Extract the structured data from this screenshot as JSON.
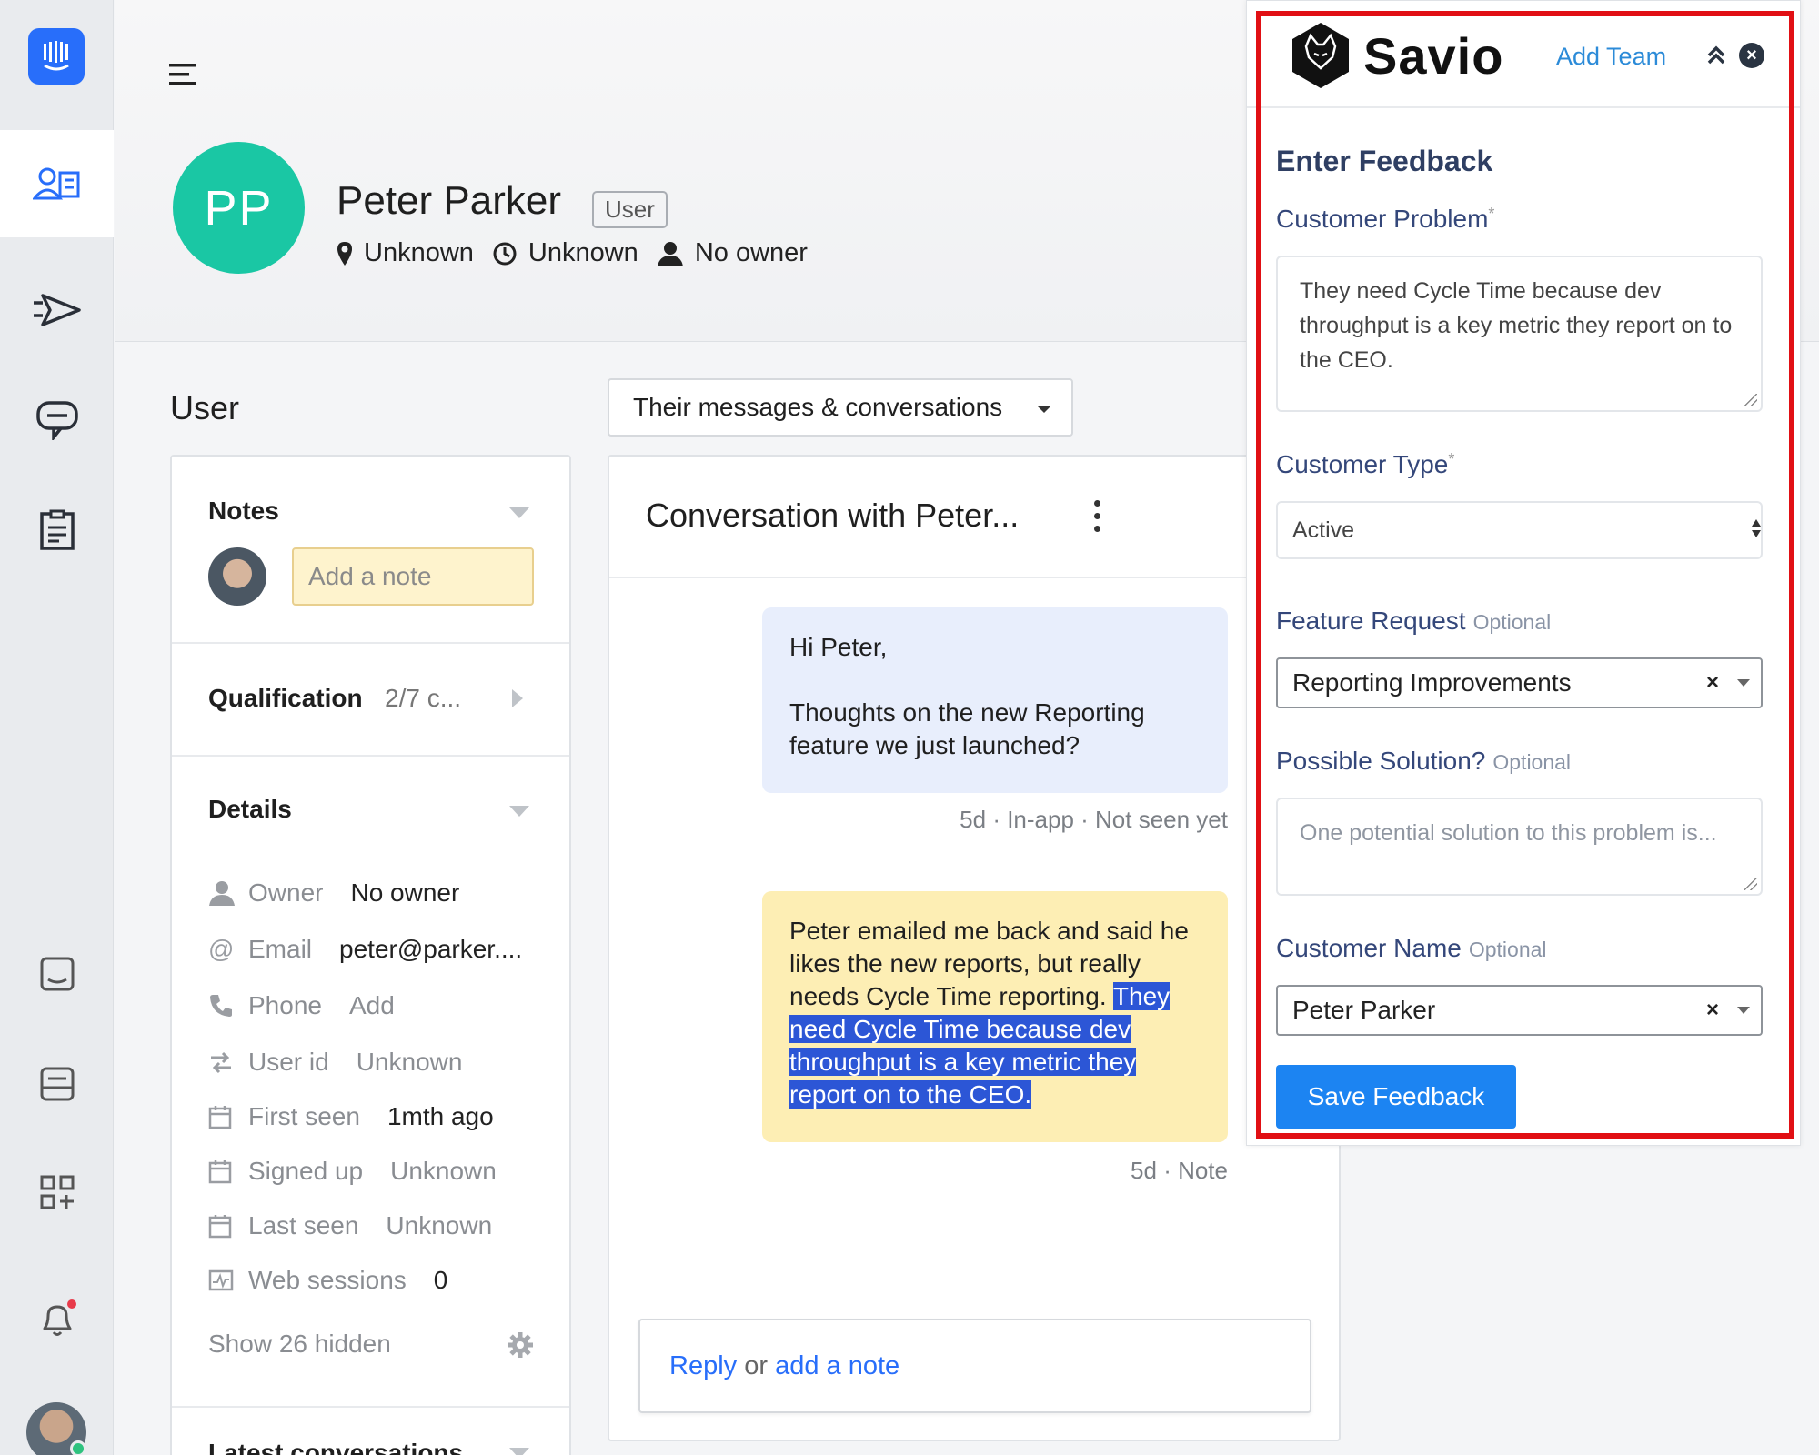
{
  "header": {
    "initials": "PP",
    "name": "Peter Parker",
    "badge": "User",
    "location": "Unknown",
    "timezone": "Unknown",
    "owner": "No owner"
  },
  "user_panel": {
    "section_title": "User",
    "notes": {
      "title": "Notes",
      "placeholder": "Add a note"
    },
    "qualification": {
      "title": "Qualification",
      "value": "2/7 c..."
    },
    "details": {
      "title": "Details",
      "items": [
        {
          "key": "Owner",
          "value": "No owner"
        },
        {
          "key": "Email",
          "value": "peter@parker...."
        },
        {
          "key": "Phone",
          "value": "Add"
        },
        {
          "key": "User id",
          "value": "Unknown"
        },
        {
          "key": "First seen",
          "value": "1mth ago"
        },
        {
          "key": "Signed up",
          "value": "Unknown"
        },
        {
          "key": "Last seen",
          "value": "Unknown"
        },
        {
          "key": "Web sessions",
          "value": "0"
        }
      ],
      "show_hidden": "Show 26 hidden"
    },
    "latest": "Latest conversations"
  },
  "conversation": {
    "filter": "Their messages & conversations",
    "title": "Conversation with Peter...",
    "message": {
      "greeting": "Hi Peter,",
      "body": "Thoughts on the new Reporting feature we just launched?",
      "meta": "5d · In-app · Not seen yet"
    },
    "note": {
      "plain": "Peter emailed me back and said he likes the new reports, but really needs Cycle Time reporting. ",
      "highlighted": "They need Cycle Time because dev throughput is a key metric they report on to the CEO. ",
      "meta": "5d · Note"
    },
    "reply": {
      "reply": "Reply",
      "or": " or ",
      "note": "add a note"
    }
  },
  "savio": {
    "brand": "Savio",
    "add_team": "Add Team",
    "title": "Enter Feedback",
    "problem_label": "Customer Problem",
    "problem_value": "They need Cycle Time because dev throughput is a key metric they report on to the CEO.",
    "type_label": "Customer Type",
    "type_value": "Active",
    "feature_label": "Feature Request",
    "feature_value": "Reporting Improvements",
    "solution_label": "Possible Solution?",
    "solution_placeholder": "One potential solution to this problem is...",
    "name_label": "Customer Name",
    "name_value": "Peter Parker",
    "optional": "Optional",
    "required": "*",
    "save": "Save Feedback",
    "clear": "×"
  },
  "colors": {
    "accent": "#286efa",
    "highlight_frame": "#e10f14",
    "save": "#1c84f2",
    "avatar": "#1ac7a4"
  }
}
